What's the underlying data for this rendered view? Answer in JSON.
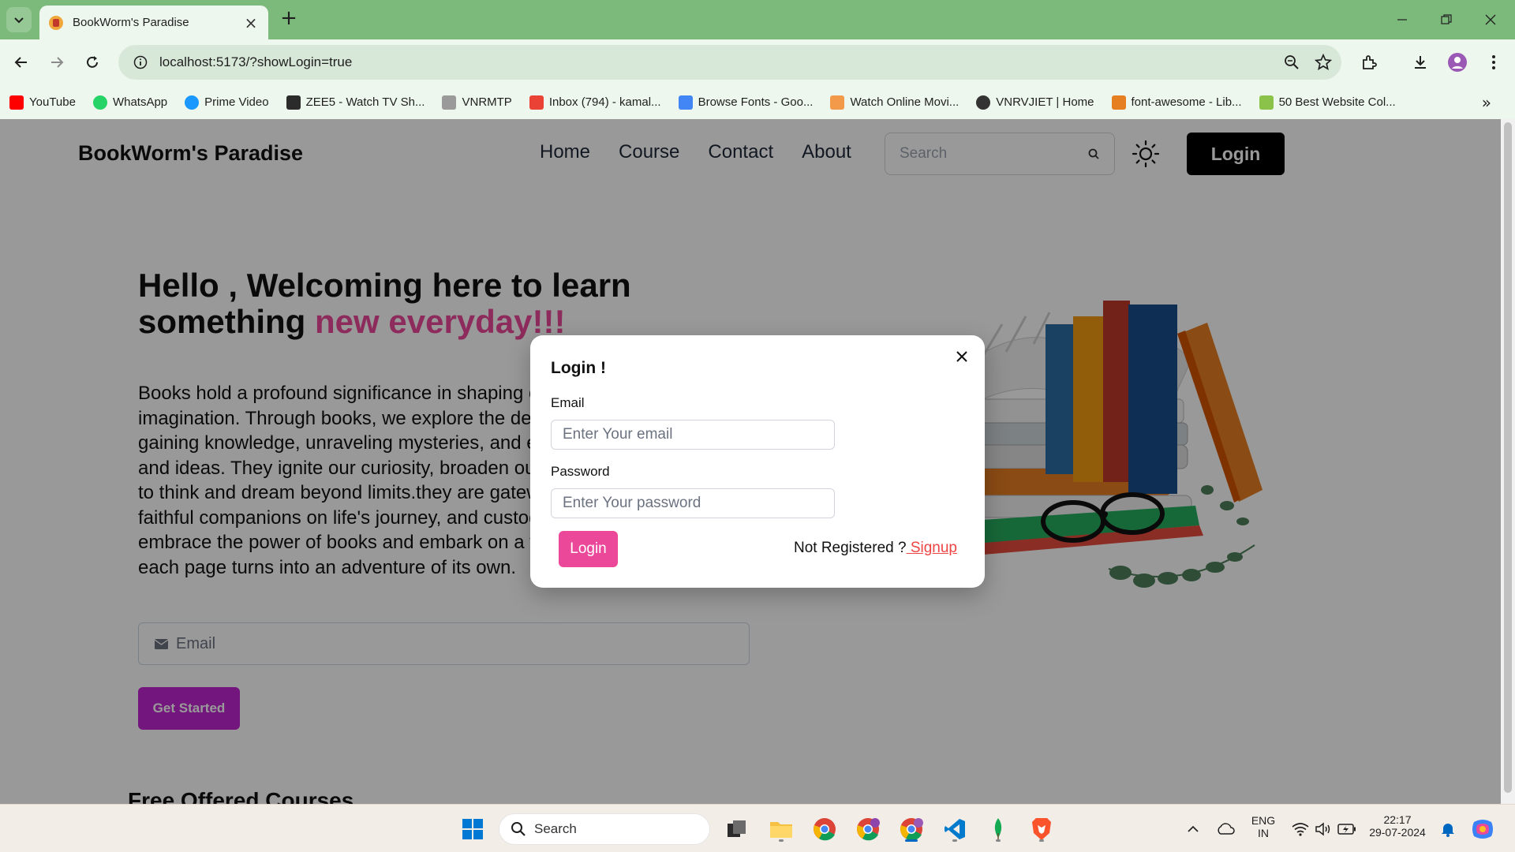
{
  "browser": {
    "tab_title": "BookWorm's Paradise",
    "url": "localhost:5173/?showLogin=true",
    "bookmarks": [
      {
        "label": "YouTube",
        "icon": "youtube-icon",
        "color": "#ff0000"
      },
      {
        "label": "WhatsApp",
        "icon": "whatsapp-icon",
        "color": "#25d366"
      },
      {
        "label": "Prime Video",
        "icon": "prime-video-icon",
        "color": "#1a98ff"
      },
      {
        "label": "ZEE5 - Watch TV Sh...",
        "icon": "zee5-icon",
        "color": "#2b2b2b"
      },
      {
        "label": "VNRMTP",
        "icon": "vnrmtp-icon",
        "color": "#9a9a9a"
      },
      {
        "label": "Inbox (794) - kamal...",
        "icon": "gmail-icon",
        "color": "#ea4335"
      },
      {
        "label": "Browse Fonts - Goo...",
        "icon": "google-fonts-icon",
        "color": "#4285f4"
      },
      {
        "label": "Watch Online Movi...",
        "icon": "movies-icon",
        "color": "#f2994a"
      },
      {
        "label": "VNRVJIET | Home",
        "icon": "globe-icon",
        "color": "#333333"
      },
      {
        "label": "font-awesome - Lib...",
        "icon": "code-icon",
        "color": "#e67e22"
      },
      {
        "label": "50 Best Website Col...",
        "icon": "d-icon",
        "color": "#8bc34a"
      }
    ]
  },
  "site": {
    "brand": "BookWorm's Paradise",
    "nav_links": [
      "Home",
      "Course",
      "Contact",
      "About"
    ],
    "search_placeholder": "Search",
    "login_button": "Login",
    "hero": {
      "title_part1": "Hello , Welcoming here to learn something ",
      "title_accent": "new everyday!!!",
      "paragraph": "Books hold a profound significance in shaping our minds and nurturing our imagination. Through books, we explore the depths of human experience, gaining knowledge, unraveling mysteries, and encountering new worlds and ideas. They ignite our curiosity, broaden our horizons, and inspire us to think and dream beyond limits.they are gateways to enlightenment, faithful companions on life's journey, and custodians of wisdom. So, embrace the power of books and embark on a voyage of discovery, where each page turns into an adventure of its own.",
      "email_placeholder": "Email",
      "cta": "Get Started"
    },
    "section_heading": "Free Offered Courses"
  },
  "modal": {
    "title": "Login !",
    "email_label": "Email",
    "email_placeholder": "Enter Your email",
    "password_label": "Password",
    "password_placeholder": "Enter Your password",
    "submit": "Login",
    "not_registered": "Not Registered ?",
    "signup": " Signup"
  },
  "taskbar": {
    "search": "Search",
    "lang_line1": "ENG",
    "lang_line2": "IN",
    "time": "22:17",
    "date": "29-07-2024"
  },
  "colors": {
    "tabstrip": "#7cba7c",
    "accent_pink": "#ec4899",
    "cta_purple": "#c026d3"
  }
}
